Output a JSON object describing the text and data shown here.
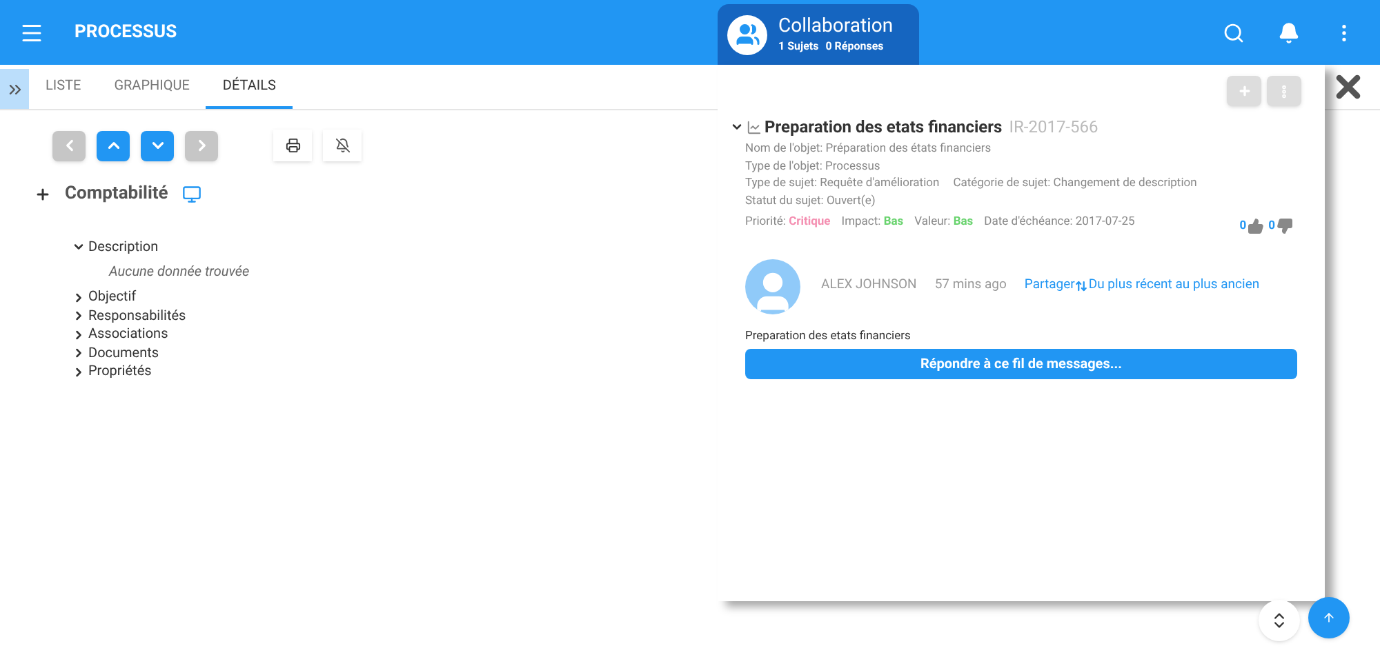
{
  "header": {
    "title": "PROCESSUS"
  },
  "collaboration": {
    "title": "Collaboration",
    "subjects": "1 Sujets",
    "replies": "0 Réponses"
  },
  "tabs": [
    {
      "label": "LISTE",
      "selected": false
    },
    {
      "label": "GRAPHIQUE",
      "selected": false
    },
    {
      "label": "DÉTAILS",
      "selected": true
    }
  ],
  "nav_buttons": [
    {
      "kind": "left",
      "disabled": true
    },
    {
      "kind": "up",
      "disabled": false
    },
    {
      "kind": "down",
      "disabled": false
    },
    {
      "kind": "right",
      "disabled": true
    }
  ],
  "object": {
    "title": "Comptabilité"
  },
  "sections": [
    {
      "label": "Description",
      "expanded": true,
      "note": "Aucune donnée trouvée"
    },
    {
      "label": "Objectif",
      "expanded": false
    },
    {
      "label": "Responsabilités",
      "expanded": false
    },
    {
      "label": "Associations",
      "expanded": false
    },
    {
      "label": "Documents",
      "expanded": false
    },
    {
      "label": "Propriétés",
      "expanded": false
    }
  ],
  "topic": {
    "title": "Preparation des etats financiers",
    "id": "IR-2017-566",
    "expanded": true,
    "lines": [
      [
        {
          "text": "Nom de l'objet: Préparation des états financiers"
        }
      ],
      [
        {
          "text": "Type de l'objet: Processus"
        }
      ],
      [
        {
          "text": "Type de sujet: Requête d'amélioration"
        },
        {
          "text": "Catégorie de sujet: Changement de description"
        }
      ],
      [
        {
          "text": "Statut du sujet: Ouvert(e)"
        }
      ]
    ],
    "ratings": [
      {
        "label": "Priorité:",
        "value": "Critique",
        "color": "#f48fb1"
      },
      {
        "label": "Impact:",
        "value": "Bas",
        "color": "#69d36e"
      },
      {
        "label": "Valeur:",
        "value": "Bas",
        "color": "#69d36e"
      }
    ],
    "due": "Date d'échéance: 2017-07-25",
    "likes": "0",
    "dislikes": "0"
  },
  "post": {
    "author": "ALEX JOHNSON",
    "time": "57 mins ago",
    "share": "Partager",
    "sort": "Du plus récent au plus ancien",
    "body": "Preparation des etats financiers",
    "reply": "Répondre à ce fil de messages..."
  }
}
